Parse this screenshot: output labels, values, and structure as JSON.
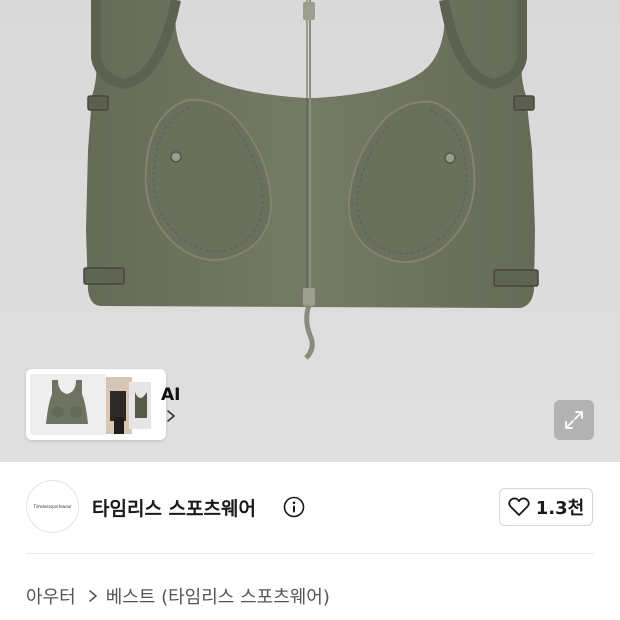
{
  "product_gallery": {
    "ai_card": {
      "label": "AI",
      "chevron_icon": "chevron-right-icon"
    },
    "expand_icon": "expand-icon"
  },
  "brand": {
    "logo_text": "Timelesssportswear",
    "name": "타임리스 스포츠웨어",
    "info_icon": "info-icon"
  },
  "like": {
    "icon": "heart-icon",
    "count": "1.3천"
  },
  "breadcrumb": {
    "items": [
      "아우터",
      "베스트 (타임리스 스포츠웨어)"
    ],
    "separator_icon": "chevron-right-icon"
  },
  "colors": {
    "vest": "#6e7461",
    "background": "#d9d9d9"
  }
}
